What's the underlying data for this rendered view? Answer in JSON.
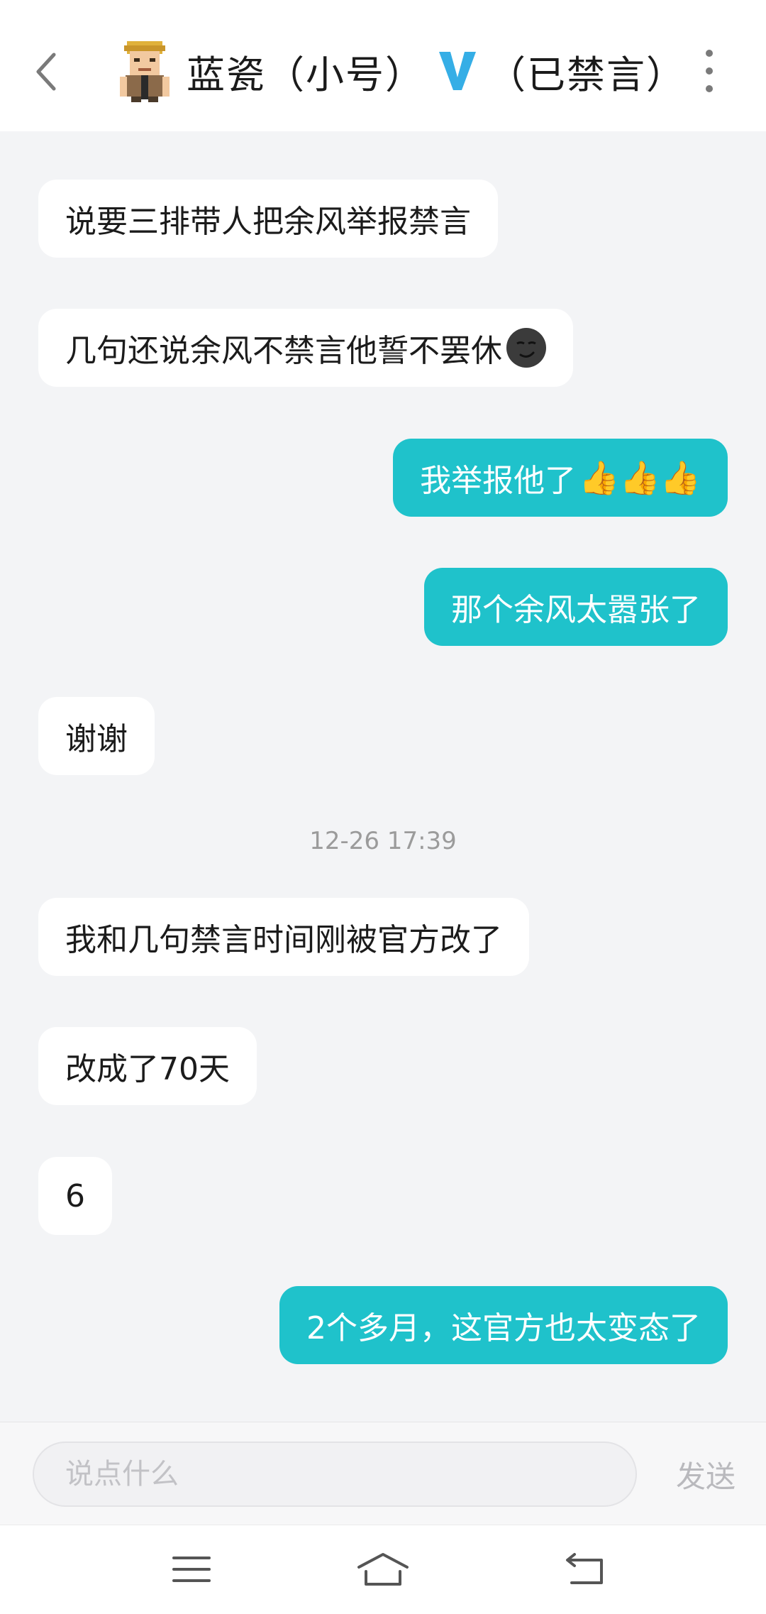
{
  "header": {
    "contact_name": "蓝瓷（小号）",
    "vip_badge": "V",
    "status": "（已禁言）",
    "icons": {
      "back": "chevron-left-icon",
      "more": "more-vertical-icon"
    }
  },
  "messages": [
    {
      "side": "in",
      "text": "说要三排带人把余风举报禁言"
    },
    {
      "side": "in",
      "text": "几句还说余风不禁言他誓不罢休",
      "emoji": "smirking-face-dark"
    },
    {
      "side": "out",
      "text": "我举报他了",
      "emoji": "👍👍👍"
    },
    {
      "side": "out",
      "text": "那个余风太嚣张了"
    },
    {
      "side": "in",
      "text": "谢谢"
    },
    {
      "side": "in",
      "text": "我和几句禁言时间刚被官方改了"
    },
    {
      "side": "in",
      "text": "改成了70天"
    },
    {
      "side": "in",
      "text": "6"
    },
    {
      "side": "out",
      "text": "2个多月，这官方也太变态了"
    }
  ],
  "timestamp": "12-26 17:39",
  "composer": {
    "placeholder": "说点什么",
    "value": "",
    "send_label": "发送"
  },
  "system_nav": {
    "icons": [
      "menu-icon",
      "home-icon",
      "back-icon"
    ]
  },
  "colors": {
    "accent": "#1fc2cb",
    "vip_blue": "#35aee6",
    "background": "#f3f4f6"
  }
}
